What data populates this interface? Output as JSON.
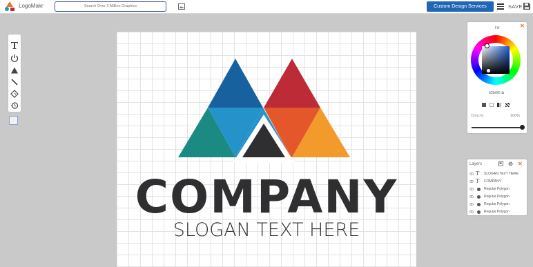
{
  "app": {
    "name": "LogoMakr",
    "search_placeholder": "Search Over 3 Million Graphics",
    "custom_design_label": "Custom Design Services",
    "save_label": "SAVE"
  },
  "colors": {
    "primary": "#1f66b5",
    "accent": "#e8742b",
    "tri_blue_dark": "#17629e",
    "tri_blue": "#2592c9",
    "tri_teal": "#1b8a82",
    "tri_red": "#bd2b36",
    "tri_orange_dark": "#e3572a",
    "tri_orange": "#f39a2d",
    "tri_charcoal": "#2f2f31"
  },
  "toolbar": {
    "tools": [
      "text-tool-icon",
      "power-shape-icon",
      "triangle-shape-icon",
      "line-tool-icon",
      "sticker-icon",
      "history-icon"
    ]
  },
  "canvas": {
    "company": "COMPANY",
    "slogan": "SLOGAN TEXT HERE"
  },
  "fill_panel": {
    "title": "Fill",
    "hex": "62b0f6",
    "opacity_label": "Opacity",
    "opacity_value": "100%",
    "opacity": 1.0
  },
  "layers_panel": {
    "title": "Layers",
    "items": [
      {
        "type": "text",
        "label": "SLOGAN TEXT HERE"
      },
      {
        "type": "text",
        "label": "COMPANY"
      },
      {
        "type": "shape",
        "label": "Regular Polygon"
      },
      {
        "type": "shape",
        "label": "Regular Polygon"
      },
      {
        "type": "shape",
        "label": "Regular Polygon"
      },
      {
        "type": "shape",
        "label": "Regular Polygon"
      }
    ]
  }
}
